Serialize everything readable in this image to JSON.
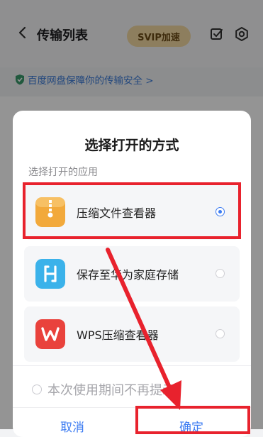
{
  "header": {
    "title": "传输列表",
    "svip_label": "SVIP加速"
  },
  "security_banner": {
    "text": "百度网盘保障你的传输安全 >"
  },
  "dialog": {
    "title": "选择打开的方式",
    "subtitle": "选择打开的应用",
    "options": [
      {
        "label": "压缩文件查看器",
        "icon": "zip-folder-icon",
        "selected": true,
        "color": "#f2a93b"
      },
      {
        "label": "保存至华为家庭存储",
        "icon": "huawei-home-storage-icon",
        "selected": false,
        "color": "#3bb2ea"
      },
      {
        "label": "WPS压缩查看器",
        "icon": "wps-icon",
        "selected": false,
        "color": "#e9423c"
      }
    ],
    "remember_label": "本次使用期间不再提示",
    "cancel_label": "取消",
    "confirm_label": "确定"
  },
  "colors": {
    "accent": "#3d7cf2",
    "annotation": "#e8222d"
  }
}
